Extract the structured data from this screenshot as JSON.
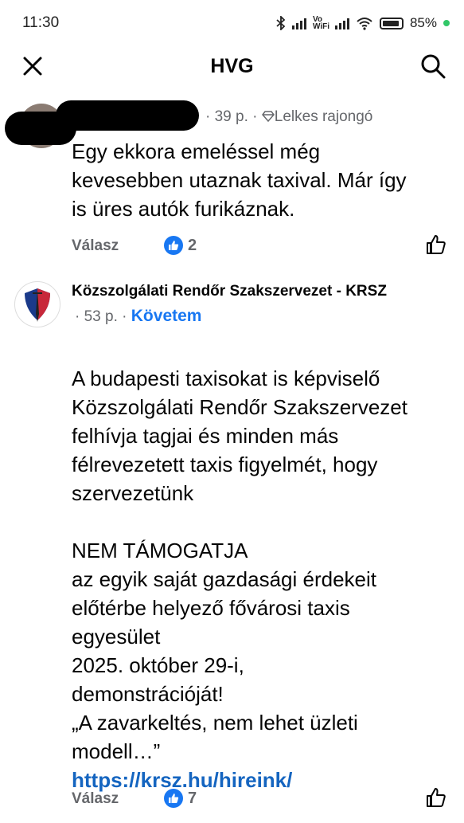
{
  "status_bar": {
    "time": "11:30",
    "network": "Vo WiFi",
    "battery": "85%"
  },
  "header": {
    "title": "HVG"
  },
  "comments": [
    {
      "time": "· 39 p. ·",
      "badge": "Lelkes rajongó",
      "text": "Egy ekkora emeléssel még\nkevesebben utaznak taxival. Már így\nis üres autók furikáznak.",
      "reply_label": "Válasz",
      "reaction_count": "2"
    },
    {
      "author": "Közszolgálati Rendőr Szakszervezet - KRSZ",
      "time": "· 53 p. ·",
      "follow_label": "Követem",
      "text": "A budapesti taxisokat is képviselő\nKözszolgálati Rendőr Szakszervezet\nfelhívja tagjai és minden más\nfélrevezetett taxis figyelmét, hogy\nszervezetünk\n\nNEM TÁMOGATJA\naz egyik saját gazdasági érdekeit\nelőtérbe helyező fővárosi taxis\negyesület\n2025. október 29-i,\ndemonstrációját!\n„A zavarkeltés, nem lehet üzleti\nmodell…”",
      "link": "https://krsz.hu/hireink/",
      "reply_label": "Válasz",
      "reaction_count": "7"
    }
  ]
}
